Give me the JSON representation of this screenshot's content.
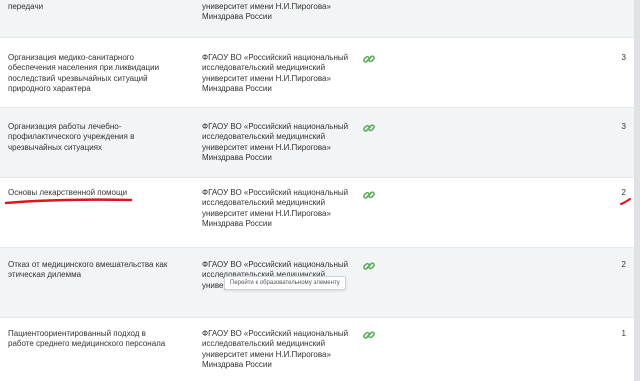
{
  "rows": [
    {
      "title": "передачи",
      "org": "университет имени Н.И.Пирогова» Минздрава России",
      "count": ""
    },
    {
      "title": "Организация медико-санитарного обеспечения населения при ликвидации последствий чрезвычайных ситуаций природного характера",
      "org": "ФГАОУ ВО «Российский национальный исследовательский медицинский университет имени Н.И.Пирогова» Минздрава России",
      "count": "3"
    },
    {
      "title": "Организация работы лечебно-профилактического учреждения в чрезвычайных ситуациях",
      "org": "ФГАОУ ВО «Российский национальный исследовательский медицинский университет имени Н.И.Пирогова» Минздрава России",
      "count": "3"
    },
    {
      "title": "Основы лекарственной помощи",
      "org": "ФГАОУ ВО «Российский национальный исследовательский медицинский университет имени Н.И.Пирогова» Минздрава России",
      "count": "2"
    },
    {
      "title": "Отказ от медицинского вмешательства как этическая дилемма",
      "org": "ФГАОУ ВО «Российский национальный исследовательский медицинский универс",
      "count": "2"
    },
    {
      "title": "Пациентоориентированный подход в работе среднего медицинского персонала",
      "org": "ФГАОУ ВО «Российский национальный исследовательский медицинский университет имени Н.И.Пирогова» Минздрава России",
      "count": "1"
    }
  ],
  "tooltip": "Перейти к образовательному элементу",
  "icon_name": "link-icon",
  "colors": {
    "icon_green": "#5db05d",
    "annotation_red": "#e0141b"
  }
}
